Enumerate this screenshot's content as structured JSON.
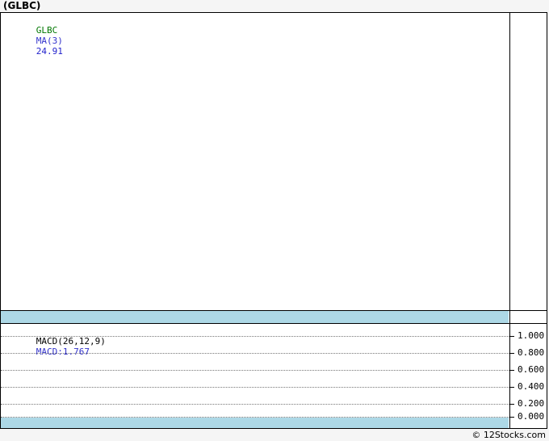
{
  "window": {
    "title": "(GLBC)"
  },
  "main_panel": {
    "legend": {
      "symbol": "GLBC",
      "ma_label": "MA(3)",
      "ma_value": "24.91"
    }
  },
  "macd_panel": {
    "indicator_label": "MACD(26,12,9)",
    "indicator_value": "MACD:1.767",
    "axis": {
      "ticks": [
        "1.000",
        "0.800",
        "0.600",
        "0.400",
        "0.200",
        "0.000"
      ]
    }
  },
  "footer": {
    "copyright": "© 12Stocks.com"
  },
  "colors": {
    "symbol_green": "#007700",
    "indicator_blue": "#3333cc",
    "value_blue": "#2222cc",
    "band_blue": "#add8e6",
    "background_gray": "#f5f5f5",
    "border_black": "#000000"
  },
  "chart_data": [
    {
      "type": "line",
      "panel": "price",
      "title": "(GLBC)",
      "series": [
        {
          "name": "GLBC",
          "color": "#007700",
          "values": []
        },
        {
          "name": "MA(3)",
          "color": "#3333cc",
          "values": [],
          "last_value": 24.91
        }
      ],
      "legend_position": "top-left",
      "grid": false
    },
    {
      "type": "line",
      "panel": "indicator",
      "title": "MACD(26,12,9)",
      "series": [
        {
          "name": "MACD",
          "color": "#3333cc",
          "values": [],
          "last_value": 1.767
        }
      ],
      "ylim": [
        0.0,
        1.0
      ],
      "yticks": [
        1.0,
        0.8,
        0.6,
        0.4,
        0.2,
        0.0
      ],
      "legend_position": "top-left",
      "grid": true
    }
  ]
}
